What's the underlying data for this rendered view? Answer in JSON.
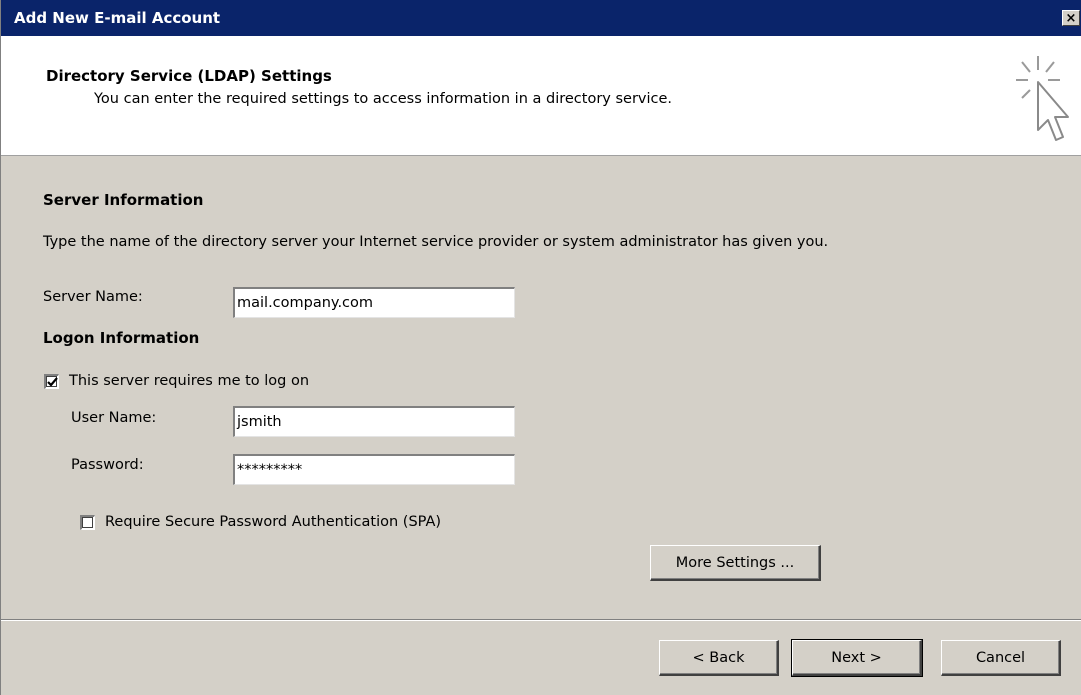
{
  "window": {
    "title": "Add New E-mail Account",
    "close_label": "×"
  },
  "header": {
    "title": "Directory Service (LDAP) Settings",
    "subtitle": "You can enter the required settings to access information in a directory service.",
    "icon": "wizard-cursor-icon"
  },
  "server_info": {
    "heading": "Server Information",
    "description": "Type the name of the directory server your Internet service provider or system administrator has given you.",
    "server_name_label": "Server Name:",
    "server_name_value": "mail.company.com"
  },
  "logon_info": {
    "heading": "Logon Information",
    "requires_logon_label": "This server requires me to log on",
    "requires_logon_checked": true,
    "user_name_label": "User Name:",
    "user_name_value": "jsmith",
    "password_label": "Password:",
    "password_value": "*********",
    "spa_label": "Require Secure Password Authentication (SPA)",
    "spa_checked": false,
    "more_settings_label": "More Settings ..."
  },
  "footer": {
    "back_label": "< Back",
    "next_label": "Next >",
    "cancel_label": "Cancel"
  },
  "colors": {
    "titlebar": "#0a246a",
    "dialog_bg": "#d4d0c8",
    "header_bg": "#ffffff"
  }
}
